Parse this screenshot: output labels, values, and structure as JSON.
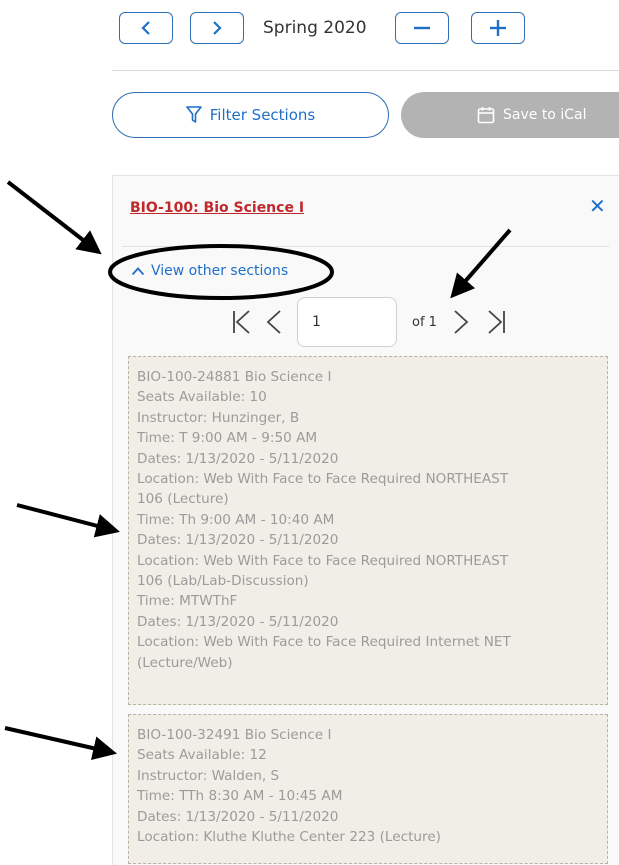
{
  "term_nav": {
    "term": "Spring 2020",
    "icons": [
      "chevron-left-icon",
      "chevron-right-icon",
      "minus-icon",
      "plus-icon"
    ]
  },
  "actions": {
    "filter_label": "Filter Sections",
    "ical_label": "Save to iCal",
    "icons": [
      "filter-icon",
      "calendar-icon"
    ]
  },
  "course": {
    "title": "BIO-100: Bio Science I",
    "close_symbol": "✕",
    "view_other_label": "View other sections"
  },
  "pager": {
    "current_page": "1",
    "of_label": "of 1",
    "icons": [
      "first-page-icon",
      "prev-page-icon",
      "next-page-icon",
      "last-page-icon"
    ]
  },
  "sections": [
    {
      "lines": [
        "BIO-100-24881 Bio Science I",
        "Seats Available: 10",
        "Instructor: Hunzinger, B",
        "Time: T 9:00 AM - 9:50 AM",
        "Dates: 1/13/2020 - 5/11/2020",
        "Location: Web With Face to Face Required NORTHEAST",
        "106 (Lecture)",
        "Time: Th 9:00 AM - 10:40 AM",
        "Dates: 1/13/2020 - 5/11/2020",
        "Location: Web With Face to Face Required NORTHEAST",
        "106 (Lab/Lab-Discussion)",
        "Time: MTWThF",
        "Dates: 1/13/2020 - 5/11/2020",
        "Location: Web With Face to Face Required Internet NET",
        "(Lecture/Web)"
      ]
    },
    {
      "lines": [
        "BIO-100-32491 Bio Science I",
        "Seats Available: 12",
        "Instructor: Walden, S",
        "Time: TTh 8:30 AM - 10:45 AM",
        "Dates: 1/13/2020 - 5/11/2020",
        "Location: Kluthe Kluthe Center 223 (Lecture)"
      ]
    }
  ],
  "colors": {
    "accent": "#1e6fc7",
    "course_title": "#c0282c",
    "card_bg": "#f1eee7",
    "card_text": "#9b9b9b",
    "disabled_button": "#b3b3b3"
  }
}
